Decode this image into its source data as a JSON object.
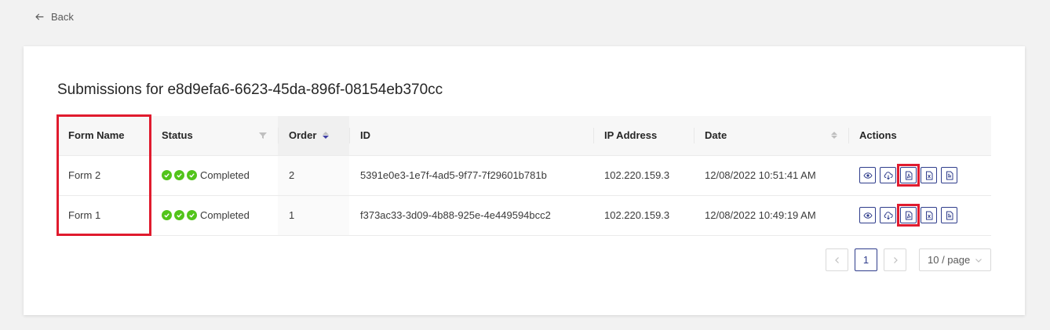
{
  "nav": {
    "back_label": "Back"
  },
  "page": {
    "title": "Submissions for e8d9efa6-6623-45da-896f-08154eb370cc"
  },
  "table": {
    "columns": {
      "form_name": "Form Name",
      "status": "Status",
      "order": "Order",
      "id": "ID",
      "ip": "IP Address",
      "date": "Date",
      "actions": "Actions"
    },
    "rows": [
      {
        "form_name": "Form 2",
        "status": "Completed",
        "order": "2",
        "id": "5391e0e3-1e7f-4ad5-9f77-7f29601b781b",
        "ip": "102.220.159.3",
        "date": "12/08/2022 10:51:41 AM"
      },
      {
        "form_name": "Form 1",
        "status": "Completed",
        "order": "1",
        "id": "f373ac33-3d09-4b88-925e-4e449594bcc2",
        "ip": "102.220.159.3",
        "date": "12/08/2022 10:49:19 AM"
      }
    ],
    "action_icons": [
      "eye-icon",
      "cloud-download-icon",
      "file-pdf-icon",
      "file-excel-icon",
      "file-text-icon"
    ]
  },
  "pagination": {
    "current_page": "1",
    "page_size": "10 / page"
  },
  "colors": {
    "accent": "#2f3d8c",
    "success": "#52c41a",
    "highlight": "#e01b2e"
  }
}
